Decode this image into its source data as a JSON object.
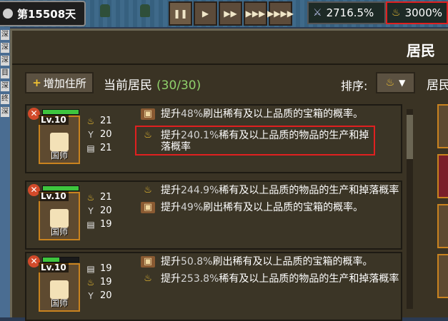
{
  "topbar": {
    "day": "第15508天",
    "controls": [
      "❚❚",
      "▶",
      "▶▶",
      "▶▶▶",
      "▶▶▶▶"
    ],
    "stat_power": {
      "value": "2716.5%",
      "icon": "sword-icon"
    },
    "stat_lamp": {
      "value": "3000%",
      "icon": "lamp-icon"
    }
  },
  "window": {
    "title": "居民",
    "add_button": "增加住所",
    "current_label": "当前居民",
    "current_count": "(30/30)",
    "sort_label": "排序:",
    "right_label": "居民"
  },
  "residents": [
    {
      "level": "Lv.10",
      "role": "国师",
      "hp_fraction": 1.0,
      "stats": [
        {
          "icon": "lamp",
          "value": "21"
        },
        {
          "icon": "cup",
          "value": "20"
        },
        {
          "icon": "scroll",
          "value": "21"
        }
      ],
      "traits": [
        {
          "icon": "chest",
          "pre": "提升",
          "num": "48%",
          "post": "刷出稀有及以上品质的宝箱的概率。",
          "highlight": false
        },
        {
          "icon": "lamp",
          "pre": "提升",
          "num": "240.1%",
          "post": "稀有及以上品质的物品的生产和掉落概率",
          "highlight": true
        }
      ]
    },
    {
      "level": "Lv.10",
      "role": "国师",
      "hp_fraction": 1.0,
      "stats": [
        {
          "icon": "lamp",
          "value": "21"
        },
        {
          "icon": "cup",
          "value": "20"
        },
        {
          "icon": "scroll",
          "value": "19"
        }
      ],
      "traits": [
        {
          "icon": "lamp",
          "pre": "提升",
          "num": "244.9%",
          "post": "稀有及以上品质的物品的生产和掉落概率",
          "highlight": false
        },
        {
          "icon": "chest",
          "pre": "提升",
          "num": "49%",
          "post": "刷出稀有及以上品质的宝箱的概率。",
          "highlight": false
        }
      ]
    },
    {
      "level": "Lv.10",
      "role": "国师",
      "hp_fraction": 0.45,
      "stats": [
        {
          "icon": "scroll",
          "value": "19"
        },
        {
          "icon": "lamp",
          "value": "19"
        },
        {
          "icon": "cup",
          "value": "20"
        }
      ],
      "traits": [
        {
          "icon": "chest",
          "pre": "提升",
          "num": "50.8%",
          "post": "刷出稀有及以上品质的宝箱的概率。",
          "highlight": false
        },
        {
          "icon": "lamp",
          "pre": "提升",
          "num": "253.8%",
          "post": "稀有及以上品质的物品的生产和掉落概率",
          "highlight": false
        }
      ]
    }
  ],
  "colors": {
    "accent_green": "#8fd16b",
    "highlight_red": "#e02020",
    "gold": "#f1c232"
  }
}
